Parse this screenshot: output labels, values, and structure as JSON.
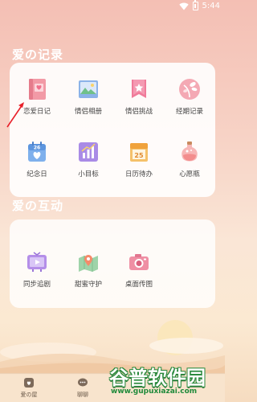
{
  "status_bar": {
    "time": "5:44"
  },
  "sections": {
    "records": {
      "title": "爱の记录",
      "items": [
        {
          "label": "恋爱日记",
          "icon": "diary-book-icon"
        },
        {
          "label": "情侣相册",
          "icon": "photo-album-icon"
        },
        {
          "label": "情侣挑战",
          "icon": "challenge-badge-icon"
        },
        {
          "label": "经期记录",
          "icon": "period-flower-icon"
        },
        {
          "label": "纪念日",
          "icon": "anniversary-calendar-icon",
          "badge": "26"
        },
        {
          "label": "小目标",
          "icon": "goal-chart-icon"
        },
        {
          "label": "日历待办",
          "icon": "calendar-todo-icon",
          "badge": "25"
        },
        {
          "label": "心愿瓶",
          "icon": "wish-bottle-icon"
        }
      ]
    },
    "interact": {
      "title": "爱の互动",
      "items": [
        {
          "label": "同步追剧",
          "icon": "tv-play-icon"
        },
        {
          "label": "甜蜜守护",
          "icon": "map-pin-icon"
        },
        {
          "label": "桌面传图",
          "icon": "camera-icon"
        }
      ]
    }
  },
  "bottom_nav": [
    {
      "label": "爱の屋",
      "icon": "home-icon"
    },
    {
      "label": "聊聊",
      "icon": "chat-bubble-icon"
    }
  ],
  "watermark": {
    "title": "谷普软件园",
    "url": "www.gupuxiazai.com"
  },
  "colors": {
    "accent_pink": "#f06f8b",
    "title_white": "#ffffff",
    "watermark_green": "#2b8a3e"
  }
}
